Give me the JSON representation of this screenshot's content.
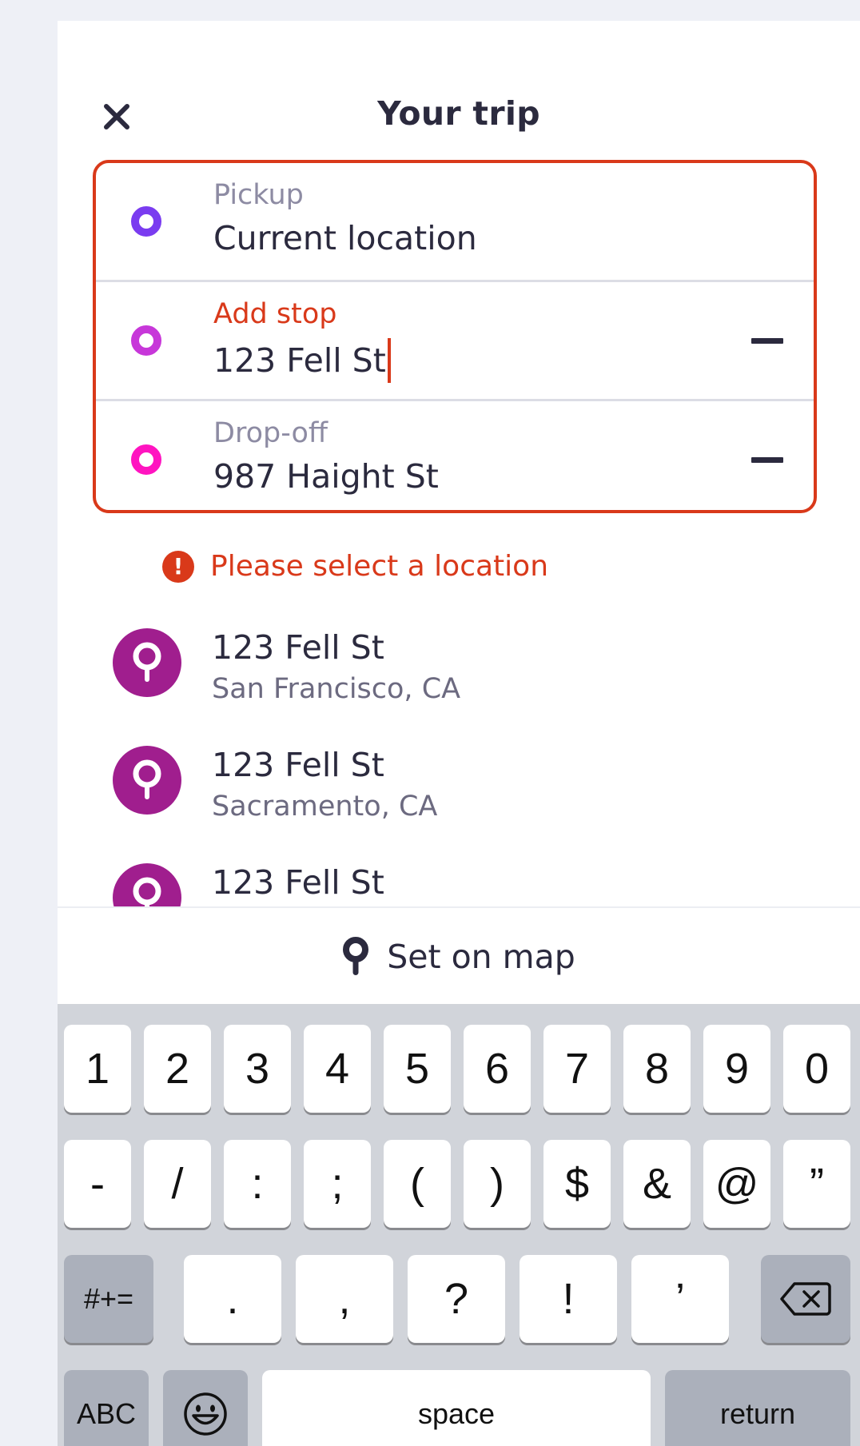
{
  "header": {
    "title": "Your trip",
    "close_icon": "close-icon"
  },
  "trip": {
    "rows": [
      {
        "label": "Pickup",
        "value": "Current location",
        "dot_color": "#7a3cf0"
      },
      {
        "label": "Add stop",
        "value": "123 Fell St",
        "dot_color": "#c737d9"
      },
      {
        "label": "Drop-off",
        "value": "987 Haight St",
        "dot_color": "#ff14c0"
      }
    ],
    "border_color": "#d9391a"
  },
  "error": {
    "message": "Please select a location",
    "icon_glyph": "!"
  },
  "suggestions": [
    {
      "title": "123 Fell St",
      "subtitle": "San Francisco, CA"
    },
    {
      "title": "123 Fell St",
      "subtitle": "Sacramento, CA"
    },
    {
      "title": "123 Fell St",
      "subtitle": ""
    }
  ],
  "set_on_map": {
    "label": "Set on map"
  },
  "keyboard": {
    "row1": [
      "1",
      "2",
      "3",
      "4",
      "5",
      "6",
      "7",
      "8",
      "9",
      "0"
    ],
    "row2": [
      "-",
      "/",
      ":",
      ";",
      "(",
      ")",
      "$",
      "&",
      "@",
      "”"
    ],
    "row3": [
      ".",
      ",",
      "?",
      "!",
      "’"
    ],
    "symbols_label": "#+=",
    "abc_label": "ABC",
    "space_label": "space",
    "return_label": "return"
  }
}
